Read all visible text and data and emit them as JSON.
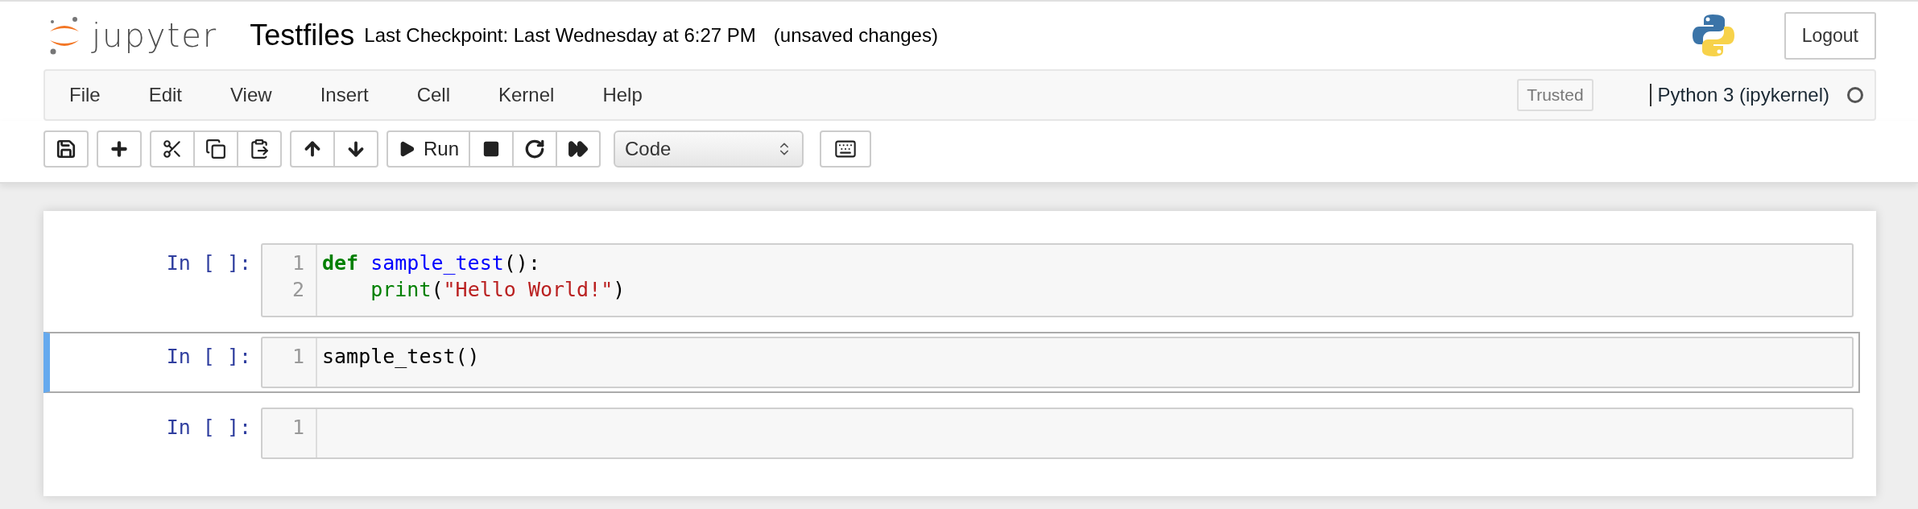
{
  "header": {
    "logo_text": "jupyter",
    "notebook_name": "Testfiles",
    "checkpoint": "Last Checkpoint: Last Wednesday at 6:27 PM",
    "autosave_status": "(unsaved changes)",
    "logout": "Logout"
  },
  "menu": [
    "File",
    "Edit",
    "View",
    "Insert",
    "Cell",
    "Kernel",
    "Help"
  ],
  "trusted": "Trusted",
  "kernel": {
    "name": "Python 3 (ipykernel)",
    "busy": false
  },
  "toolbar": {
    "run_label": "Run",
    "cell_type": "Code"
  },
  "cells": [
    {
      "prompt": "In [ ]:",
      "selected": false,
      "lines": [
        {
          "number": "1",
          "tokens": [
            {
              "text": "def",
              "kind": "keyword"
            },
            {
              "text": "sample_test",
              "kind": "def"
            },
            {
              "text": "():",
              "kind": "plain"
            }
          ]
        },
        {
          "number": "2",
          "indented": true,
          "tokens": [
            {
              "text": "print",
              "kind": "builtin"
            },
            {
              "text": "(",
              "kind": "plain"
            },
            {
              "text": "\"Hello World!\"",
              "kind": "string"
            },
            {
              "text": ")",
              "kind": "plain"
            }
          ]
        }
      ]
    },
    {
      "prompt": "In [ ]:",
      "selected": true,
      "lines": [
        {
          "number": "1",
          "tokens": [
            {
              "text": "sample_test()",
              "kind": "plain"
            }
          ]
        }
      ]
    },
    {
      "prompt": "In [ ]:",
      "selected": false,
      "lines": [
        {
          "number": "1"
        }
      ]
    }
  ]
}
